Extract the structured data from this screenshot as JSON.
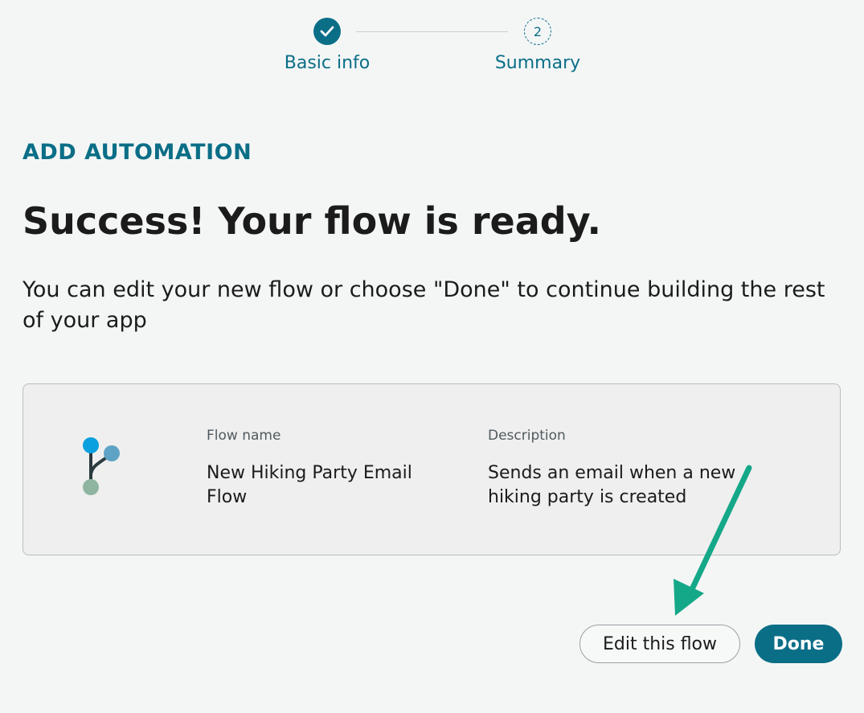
{
  "stepper": {
    "steps": [
      {
        "label": "Basic info",
        "status": "complete",
        "icon": "checkmark-icon"
      },
      {
        "label": "Summary",
        "status": "current",
        "number": "2"
      }
    ]
  },
  "header": {
    "eyebrow": "ADD AUTOMATION",
    "title": "Success! Your flow is ready.",
    "subtitle": "You can edit your new flow or choose \"Done\" to continue building the rest of your app"
  },
  "flow_card": {
    "icon": "flow-branch-icon",
    "name_label": "Flow name",
    "name_value": "New Hiking Party Email Flow",
    "description_label": "Description",
    "description_value": "Sends an email when a new hiking party is created"
  },
  "actions": {
    "edit_label": "Edit this flow",
    "done_label": "Done"
  },
  "colors": {
    "accent": "#0b6e87",
    "background": "#f4f6f6",
    "card_background": "#efefef",
    "annotation_arrow": "#14a888"
  }
}
